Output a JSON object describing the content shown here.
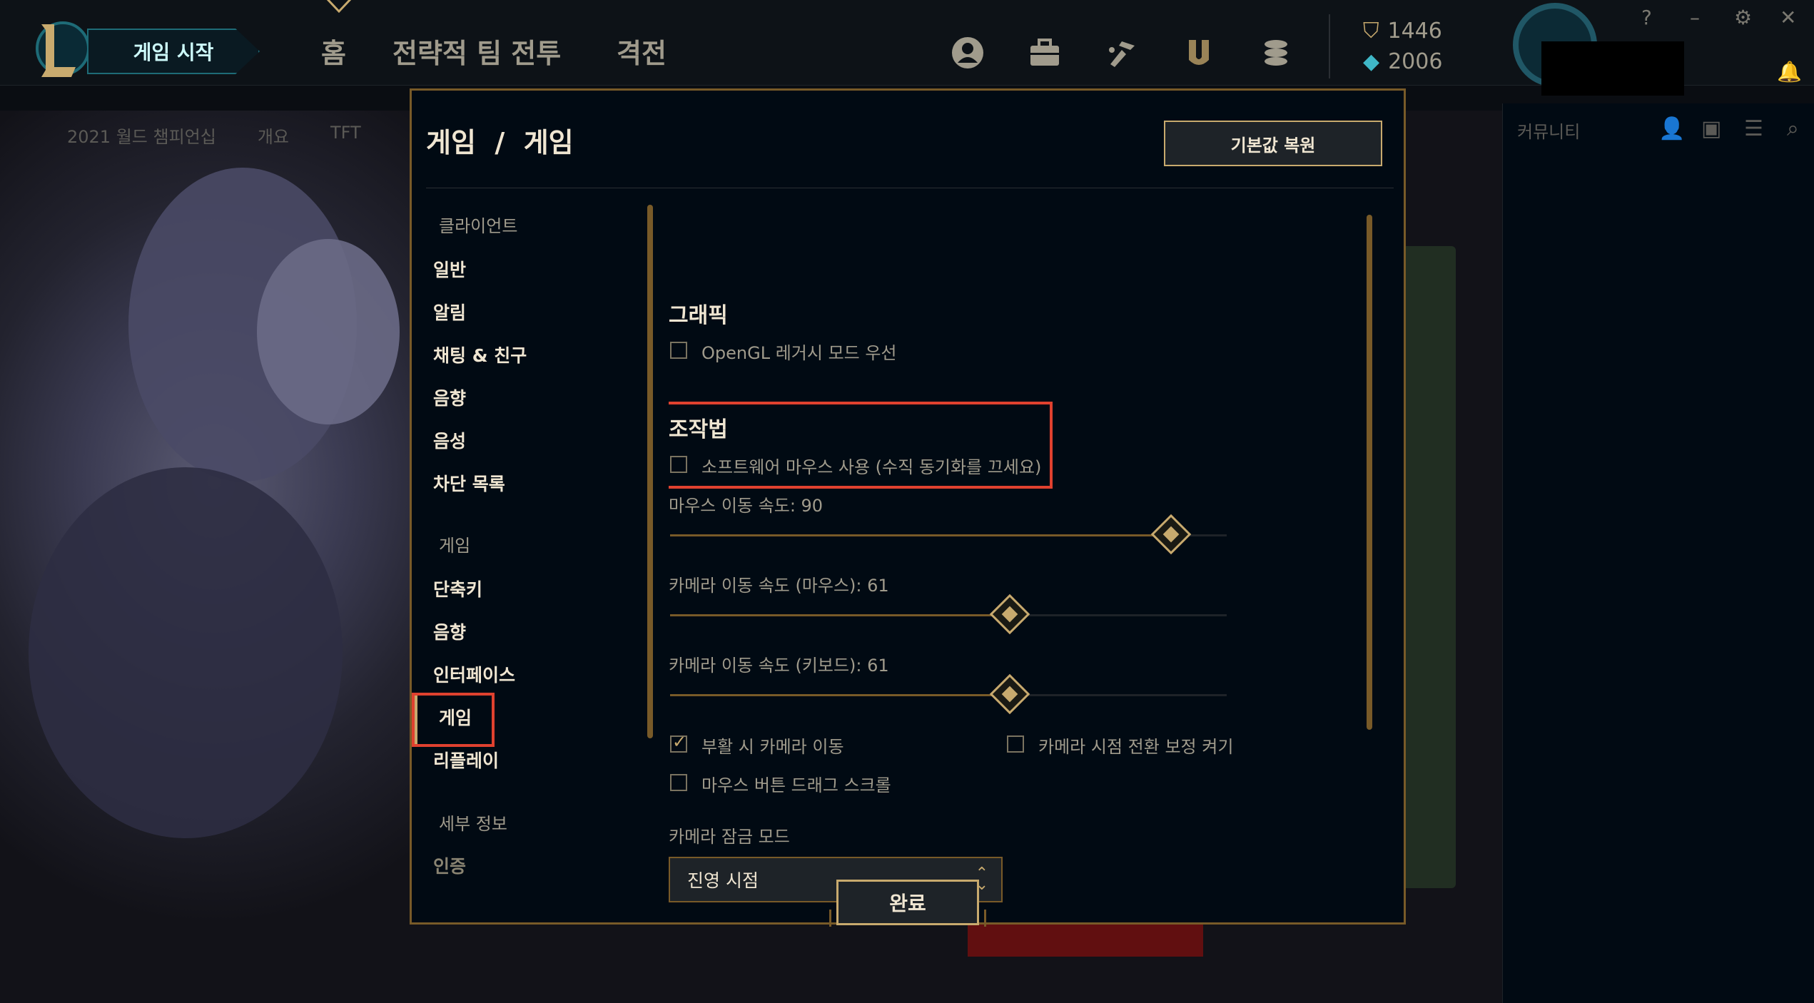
{
  "topbar": {
    "play_label": "게임 시작",
    "nav": [
      "홈",
      "전략적 팀 전투",
      "격전"
    ],
    "icons": [
      "profile-icon",
      "collection-icon",
      "loot-icon",
      "tft-icon",
      "store-icon"
    ],
    "rp": "1446",
    "be": "2006",
    "window_controls": [
      "?",
      "–",
      "⚙",
      "✕"
    ]
  },
  "subnav": [
    "2021 월드 챔피언십",
    "개요",
    "TFT"
  ],
  "social": {
    "title": "커뮤니티"
  },
  "modal": {
    "title": "게임  /  게임",
    "restore_label": "기본값 복원",
    "done_label": "완료",
    "sidebar": {
      "client_header": "클라이언트",
      "client_items": [
        "일반",
        "알림",
        "채팅 & 친구",
        "음향",
        "음성",
        "차단 목록"
      ],
      "game_header": "게임",
      "game_items": [
        "단축키",
        "음향",
        "인터페이스",
        "게임",
        "리플레이"
      ],
      "about_header": "세부 정보",
      "about_items": [
        "인증"
      ],
      "selected": "게임"
    },
    "graphics": {
      "title": "그래픽",
      "opengl_label": "OpenGL 레거시 모드 우선",
      "opengl_checked": false
    },
    "controls": {
      "title": "조작법",
      "software_mouse_label": "소프트웨어 마우스 사용 (수직 동기화를 끄세요)",
      "software_mouse_checked": false,
      "mouse_speed_label": "마우스 이동 속도: 90",
      "mouse_speed_value": 90,
      "camera_mouse_label": "카메라 이동 속도 (마우스): 61",
      "camera_mouse_value": 61,
      "camera_keyboard_label": "카메라 이동 속도 (키보드): 61",
      "camera_keyboard_value": 61,
      "respawn_camera_label": "부활 시 카메라 이동",
      "respawn_camera_checked": true,
      "camera_smoothing_label": "카메라 시점 전환 보정 켜기",
      "camera_smoothing_checked": false,
      "drag_scroll_label": "마우스 버튼 드래그 스크롤",
      "drag_scroll_checked": false,
      "camera_lock_label": "카메라 잠금 모드",
      "camera_lock_value": "진영 시점"
    }
  },
  "colors": {
    "gold": "#c8aa6e",
    "dark_gold": "#785a28",
    "highlight": "#e0412f",
    "bg": "#010a13"
  }
}
